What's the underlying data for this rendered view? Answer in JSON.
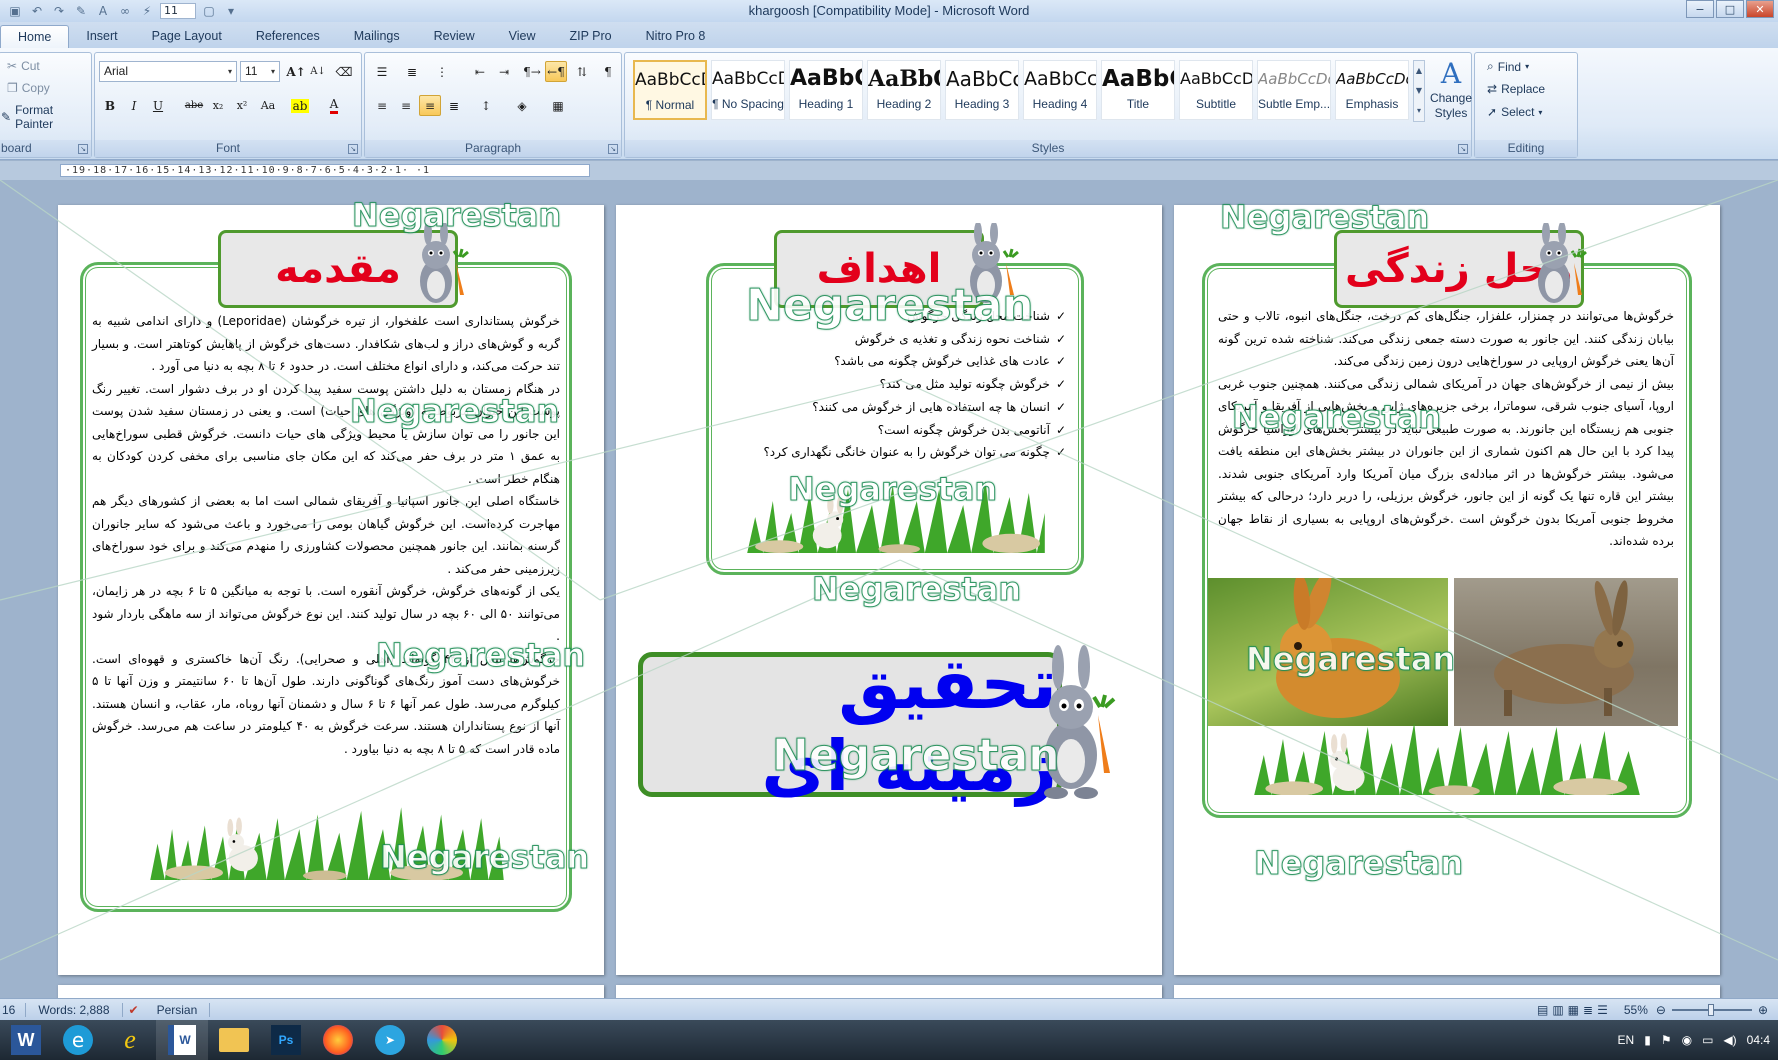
{
  "window": {
    "title": "khargoosh [Compatibility Mode] - Microsoft Word",
    "qat_font_size": "11",
    "controls": {
      "minimize": "−",
      "maximize": "□",
      "close": "✕"
    }
  },
  "tabs": [
    "Home",
    "Insert",
    "Page Layout",
    "References",
    "Mailings",
    "Review",
    "View",
    "ZIP Pro",
    "Nitro Pro 8"
  ],
  "clipboard": {
    "label": "board",
    "cut": "Cut",
    "copy": "Copy",
    "format_painter": "Format Painter"
  },
  "font": {
    "label": "Font",
    "name": "Arial",
    "size": "11",
    "bold": "B",
    "italic": "I",
    "underline": "U",
    "strike": "abe",
    "sub": "x₂",
    "sup": "x²",
    "change_case": "Aa",
    "grow": "A",
    "shrink": "A",
    "clear": "A"
  },
  "paragraph": {
    "label": "Paragraph",
    "pilcrow": "¶"
  },
  "styles": {
    "label": "Styles",
    "items": [
      {
        "sample": "AaBbCcDdEe",
        "name": "¶ Normal"
      },
      {
        "sample": "AaBbCcDdEe",
        "name": "¶ No Spacing"
      },
      {
        "sample": "AaBbCcDdEe",
        "name": "Heading 1"
      },
      {
        "sample": "AaBbCcDdEe",
        "name": "Heading 2"
      },
      {
        "sample": "AaBbCcDdEe",
        "name": "Heading 3"
      },
      {
        "sample": "AaBbCcDdEe",
        "name": "Heading 4"
      },
      {
        "sample": "AaBbCcDdEe",
        "name": "Title"
      },
      {
        "sample": "AaBbCcDdEe",
        "name": "Subtitle"
      },
      {
        "sample": "AaBbCcDdEe",
        "name": "Subtle Emp..."
      },
      {
        "sample": "AaBbCcDdEe",
        "name": "Emphasis"
      }
    ],
    "change_styles": "Change Styles"
  },
  "editing": {
    "label": "Editing",
    "find": "Find",
    "replace": "Replace",
    "select": "Select"
  },
  "ruler": {
    "ticks": "·19·18·17·16·15·14·13·12·11·10·9·8·7·6·5·4·3·2·1·  ·1"
  },
  "pages": {
    "left": {
      "heading": "مقدمه",
      "paragraphs": [
        "خرگوش پستانداری است علفخوار، از تیره خرگوشان (Leporidae) و دارای اندامی شبیه به گربه و گوش‌های دراز و لب‌های شکافدار. دست‌های خرگوش از پاهایش کوتاهتر است. و بسیار تند حرکت می‌کند، و دارای انواع مختلف است. در حدود ۶ تا ۸ بچه به دنیا می آورد .",
        "در هنگام زمستان به دلیل داشتن پوست سفید پیدا کردن او در برف دشوار است. تغییر رنگ پوست این حیوان مربوط به (ویژگی های حیات) است. و یعنی در زمستان سفید شدن پوست این جانور را می توان سازش یا محیط ویژگی های حیات دانست. خرگوش قطبی سوراخ‌هایی به عمق ۱ متر در برف حفر می‌کند که این مکان جای مناسبی برای مخفی کردن کودکان به هنگام خطر است .",
        "خاستگاه اصلی این جانور اسپانیا و آفریقای شمالی است اما به بعضی از کشورهای دیگر هم مهاجرت کرده‌است. این خرگوش گیاهان بومی را می‌خورد و باعث می‌شود که سایر جانوران گرسنه بمانند. این جانور همچنین محصولات کشاورزی را منهدم می‌کند و برای خود سوراخ‌های زیرزمینی حفر می‌کند .",
        "یکی از گونه‌های خرگوش، خرگوش آنقوره است. با توجه به میانگین ۵ تا ۶ بچه در هر زایمان، می‌توانند ۵۰ الی ۶۰ بچه در سال تولید کنند. این نوع خرگوش می‌تواند از سه ماهگی باردار شود .",
        "خرگوش‌ها بیش از ۴۴ گونه‌اند (اهلی و صحرایی). رنگ آن‌ها خاکستری و قهوه‌ای است. خرگوش‌های دست آموز رنگ‌های گوناگونی دارند. طول آن‌ها تا ۶۰ سانتیمتر و وزن آنها تا ۵ کیلوگرم می‌رسد. طول عمر آنها ۶ تا ۶ سال و دشمنان آنها روباه، مار، عقاب، و انسان هستند. آنها از نوع پستانداران هستند. سرعت خرگوش به ۴۰ کیلومتر در ساعت هم می‌رسد. خرگوش ماده قادر است که ۵ تا ۸ بچه به دنیا بیاورد ."
      ]
    },
    "middle": {
      "heading": "اهداف",
      "items": [
        "شناخت محل زندگی خرگوش",
        "شناخت نحوه زندگی و تغذیه ی خرگوش",
        "عادت های غذایی خرگوش چگونه می باشد؟",
        "خرگوش چگونه تولید مثل می کند؟",
        "انسان ها چه استفاده هایی از خرگوش می کنند؟",
        "آناتومی بدن خرگوش چگونه است؟",
        "چگونه می توان خرگوش را به عنوان خانگی نگهداری کرد؟"
      ],
      "banner": "تحقیق زمینه ای"
    },
    "right": {
      "heading": "محل زندگی",
      "paragraphs": [
        "خرگوش‌ها می‌توانند در چمنزار، علفزار، جنگل‌های کم درخت، جنگل‌های انبوه، تالاب و حتی بیابان زندگی کنند. این جانور به صورت دسته جمعی زندگی می‌کند. شناخته شده ترین گونه آن‌ها یعنی خرگوش اروپایی در سوراخ‌هایی درون زمین زندگی می‌کند.",
        "بیش از نیمی از خرگوش‌های جهان در آمریکای شمالی زندگی می‌کنند. همچنین جنوب غربی اروپا، آسیای جنوب شرقی، سوماترا، برخی جزیره‌های ژاپن و بخش‌هایی از آفریقا و آمریکای جنوبی هم زیستگاه این جانورند. به صورت طبیعی نباید در بیشتر بخش‌های اوراسیا خرگوش پیدا کرد با این حال هم اکنون شماری از این جانوران در بیشتر بخش‌های این منطقه یافت می‌شود. بیشتر خرگوش‌ها در اثر مبادله‌ی بزرگ میان آمریکا وارد آمریکای جنوبی شدند. بیشتر این قاره تنها یک گونه از این جانور، خرگوش برزیلی، را دربر دارد؛ درحالی که بیشتر مخروط جنوبی آمریکا بدون خرگوش است .خرگوش‌های اروپایی به بسیاری از نقاط جهان برده شده‌اند."
      ]
    }
  },
  "watermark": "Negarestan",
  "status": {
    "page": "16",
    "words": "Words: 2,888",
    "language": "Persian",
    "zoom": "55%"
  },
  "tray": {
    "lang": "EN",
    "time": "04:4"
  },
  "colors": {
    "heading_red": "#e3001b",
    "banner_blue": "#0000f0",
    "frame_green": "#5bb35b"
  }
}
